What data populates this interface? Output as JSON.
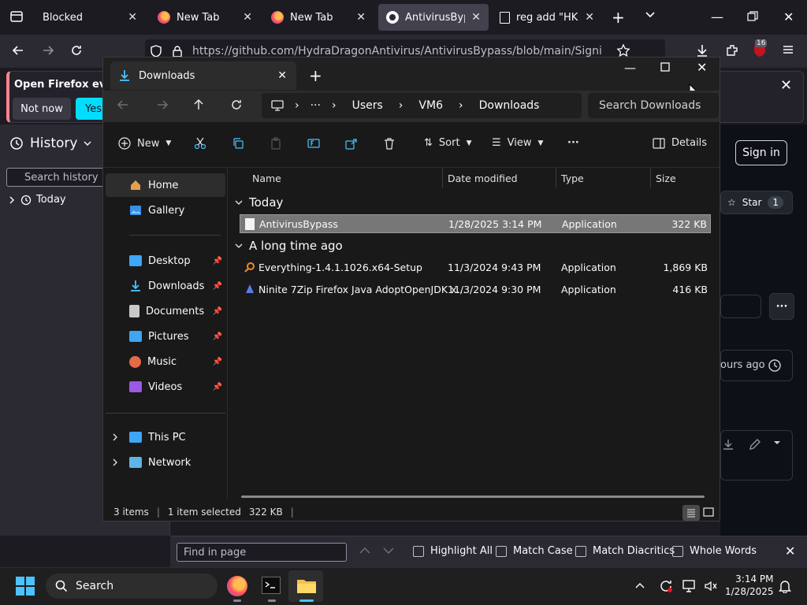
{
  "tabs": [
    {
      "title": "Blocked",
      "icon": "container-icon"
    },
    {
      "title": "New Tab",
      "icon": "firefox-icon"
    },
    {
      "title": "New Tab",
      "icon": "firefox-icon"
    },
    {
      "title": "AntivirusBypass",
      "icon": "github-icon",
      "active": true
    },
    {
      "title": "reg add \"HKLM\\",
      "icon": "document-icon"
    }
  ],
  "url": "https://github.com/HydraDragonAntivirus/AntivirusBypass/blob/main/Signing/Antivir...",
  "extension_badge": "16",
  "notification": {
    "text": "Open Firefox every",
    "not_now": "Not now",
    "yes": "Yes"
  },
  "history_sidebar": {
    "title": "History",
    "search_placeholder": "Search history",
    "today": "Today"
  },
  "github": {
    "sign_in": "Sign in",
    "star": "Star",
    "star_count": "1",
    "ago_text": "ours ago"
  },
  "explorer": {
    "tab_title": "Downloads",
    "breadcrumb": [
      "Users",
      "VM6",
      "Downloads"
    ],
    "search_placeholder": "Search Downloads",
    "commands": {
      "new": "New",
      "sort": "Sort",
      "view": "View",
      "details": "Details"
    },
    "nav": {
      "home": "Home",
      "gallery": "Gallery",
      "desktop": "Desktop",
      "downloads": "Downloads",
      "documents": "Documents",
      "pictures": "Pictures",
      "music": "Music",
      "videos": "Videos",
      "this_pc": "This PC",
      "network": "Network"
    },
    "columns": [
      "Name",
      "Date modified",
      "Type",
      "Size"
    ],
    "groups": [
      {
        "label": "Today",
        "files": [
          {
            "name": "AntivirusBypass",
            "date": "1/28/2025 3:14 PM",
            "type": "Application",
            "size": "322 KB",
            "selected": true
          }
        ]
      },
      {
        "label": "A long time ago",
        "files": [
          {
            "name": "Everything-1.4.1.1026.x64-Setup",
            "date": "11/3/2024 9:43 PM",
            "type": "Application",
            "size": "1,869 KB"
          },
          {
            "name": "Ninite 7Zip Firefox Java AdoptOpenJDK x...",
            "date": "11/3/2024 9:30 PM",
            "type": "Application",
            "size": "416 KB"
          }
        ]
      }
    ],
    "status": {
      "items": "3 items",
      "selected": "1 item selected",
      "size": "322 KB"
    }
  },
  "findbar": {
    "placeholder": "Find in page",
    "highlight_all": "Highlight All",
    "match_case": "Match Case",
    "match_diacritics": "Match Diacritics",
    "whole_words": "Whole Words"
  },
  "taskbar": {
    "search": "Search",
    "time": "3:14 PM",
    "date": "1/28/2025"
  },
  "colors": {
    "accent": "#00ddff",
    "selected_row": "#777777",
    "notification_border": "#ff848b"
  }
}
